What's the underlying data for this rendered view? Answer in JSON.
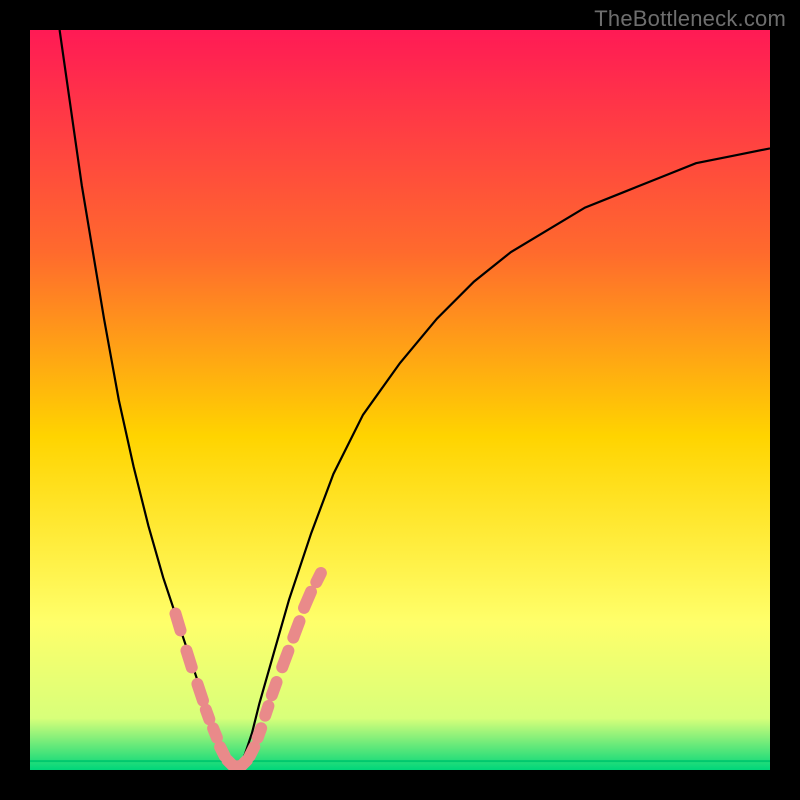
{
  "watermark": "TheBottleneck.com",
  "chart_data": {
    "type": "line",
    "title": "",
    "xlabel": "",
    "ylabel": "",
    "xlim": [
      0,
      100
    ],
    "ylim": [
      0,
      100
    ],
    "grid": false,
    "background_gradient": {
      "top": "#ff1a55",
      "mid1": "#ff6a2d",
      "mid2": "#ffd400",
      "mid3": "#ffff6a",
      "mid4": "#d8ff7a",
      "bottom": "#00d67a"
    },
    "series": [
      {
        "name": "left-curve",
        "color": "#000000",
        "x": [
          4,
          5,
          6,
          7,
          8,
          9,
          10,
          12,
          14,
          16,
          18,
          20,
          22,
          24,
          25,
          26,
          27,
          28
        ],
        "y": [
          100,
          93,
          86,
          79,
          73,
          67,
          61,
          50,
          41,
          33,
          26,
          20,
          14,
          8,
          5,
          3,
          1,
          0
        ]
      },
      {
        "name": "right-curve",
        "color": "#000000",
        "x": [
          28,
          29,
          30,
          31,
          33,
          35,
          38,
          41,
          45,
          50,
          55,
          60,
          65,
          70,
          75,
          80,
          85,
          90,
          95,
          100
        ],
        "y": [
          0,
          2,
          5,
          9,
          16,
          23,
          32,
          40,
          48,
          55,
          61,
          66,
          70,
          73,
          76,
          78,
          80,
          82,
          83,
          84
        ]
      }
    ],
    "markers": {
      "name": "beads",
      "color": "#e98a8a",
      "shape": "rounded-rect",
      "points": [
        {
          "x": 20,
          "y": 20,
          "len": 4
        },
        {
          "x": 21.5,
          "y": 15,
          "len": 4
        },
        {
          "x": 23,
          "y": 10.5,
          "len": 4
        },
        {
          "x": 24,
          "y": 7.5,
          "len": 3
        },
        {
          "x": 25,
          "y": 5,
          "len": 3
        },
        {
          "x": 26,
          "y": 2.5,
          "len": 3
        },
        {
          "x": 27,
          "y": 1,
          "len": 2.5
        },
        {
          "x": 28,
          "y": 0.5,
          "len": 2.5
        },
        {
          "x": 29,
          "y": 1,
          "len": 2.5
        },
        {
          "x": 30,
          "y": 2.5,
          "len": 3
        },
        {
          "x": 31,
          "y": 5,
          "len": 3
        },
        {
          "x": 32,
          "y": 8,
          "len": 3
        },
        {
          "x": 33,
          "y": 11,
          "len": 3.5
        },
        {
          "x": 34.5,
          "y": 15,
          "len": 4
        },
        {
          "x": 36,
          "y": 19,
          "len": 4
        },
        {
          "x": 37.5,
          "y": 23,
          "len": 4
        },
        {
          "x": 39,
          "y": 26,
          "len": 3
        }
      ]
    },
    "inner_line": {
      "name": "green-inner-line",
      "color": "#00c86e",
      "y": 1.2
    }
  }
}
